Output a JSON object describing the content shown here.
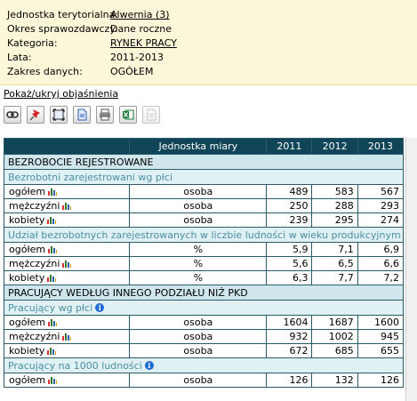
{
  "info": {
    "rows": [
      {
        "label": "Jednostka terytorialna:",
        "value": "Alwernia (3)",
        "link": true
      },
      {
        "label": "Okres sprawozdawczy:",
        "value": "Dane roczne",
        "link": false
      },
      {
        "label": "Kategoria:",
        "value": "RYNEK PRACY",
        "link": true
      },
      {
        "label": "Lata:",
        "value": "2011-2013",
        "link": false
      },
      {
        "label": "Zakres danych:",
        "value": "OGÓŁEM",
        "link": false
      }
    ]
  },
  "toggle_link": "Pokaż/ukryj objaśnienia",
  "toolbar": {
    "buttons": [
      "link-icon",
      "pin-icon",
      "fullscreen-icon",
      "document-icon",
      "print-icon",
      "excel-icon",
      "page-icon"
    ]
  },
  "table": {
    "header": {
      "unit": "Jednostka miary",
      "years": [
        "2011",
        "2012",
        "2013"
      ]
    },
    "sections": [
      {
        "title": "BEZROBOCIE REJESTROWANE",
        "groups": [
          {
            "title": "Bezrobotni zarejestrowani wg płci",
            "info": false,
            "rows": [
              {
                "name": "ogółem",
                "unit": "osoba",
                "values": [
                  "489",
                  "583",
                  "567"
                ]
              },
              {
                "name": "mężczyźni",
                "unit": "osoba",
                "values": [
                  "250",
                  "288",
                  "293"
                ]
              },
              {
                "name": "kobiety",
                "unit": "osoba",
                "values": [
                  "239",
                  "295",
                  "274"
                ]
              }
            ]
          },
          {
            "title": "Udział bezrobotnych zarejestrowanych w liczbie ludności w wieku produkcyjnym wg płci",
            "info": true,
            "rows": [
              {
                "name": "ogółem",
                "unit": "%",
                "values": [
                  "5,9",
                  "7,1",
                  "6,9"
                ]
              },
              {
                "name": "mężczyźni",
                "unit": "%",
                "values": [
                  "5,6",
                  "6,5",
                  "6,6"
                ]
              },
              {
                "name": "kobiety",
                "unit": "%",
                "values": [
                  "6,3",
                  "7,7",
                  "7,2"
                ]
              }
            ]
          }
        ]
      },
      {
        "title": "PRACUJĄCY WEDŁUG INNEGO PODZIAŁU NIŻ PKD",
        "groups": [
          {
            "title": "Pracujący wg płci",
            "info": true,
            "rows": [
              {
                "name": "ogółem",
                "unit": "osoba",
                "values": [
                  "1604",
                  "1687",
                  "1600"
                ]
              },
              {
                "name": "mężczyźni",
                "unit": "osoba",
                "values": [
                  "932",
                  "1002",
                  "945"
                ]
              },
              {
                "name": "kobiety",
                "unit": "osoba",
                "values": [
                  "672",
                  "685",
                  "655"
                ]
              }
            ]
          },
          {
            "title": "Pracujący na 1000 ludności",
            "info": true,
            "rows": [
              {
                "name": "ogółem",
                "unit": "osoba",
                "values": [
                  "126",
                  "132",
                  "126"
                ]
              }
            ]
          }
        ]
      }
    ]
  },
  "colors": {
    "header_bg": "#0f4557",
    "section_bg": "#cfe6ec",
    "subsection_bg": "#dff1f5",
    "subsection_text": "#4c8fa1",
    "info_bg": "#fdf7d9"
  }
}
